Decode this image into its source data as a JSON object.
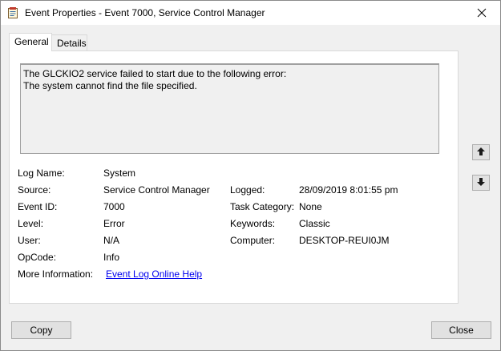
{
  "window": {
    "title": "Event Properties - Event 7000, Service Control Manager"
  },
  "tabs": [
    {
      "label": "General"
    },
    {
      "label": "Details"
    }
  ],
  "description": {
    "line1": "The GLCKIO2 service failed to start due to the following error:",
    "line2": "The system cannot find the file specified."
  },
  "fields": {
    "log_name": {
      "label": "Log Name:",
      "value": "System"
    },
    "source": {
      "label": "Source:",
      "value": "Service Control Manager"
    },
    "event_id": {
      "label": "Event ID:",
      "value": "7000"
    },
    "level": {
      "label": "Level:",
      "value": "Error"
    },
    "user": {
      "label": "User:",
      "value": "N/A"
    },
    "opcode": {
      "label": "OpCode:",
      "value": "Info"
    },
    "more_info": {
      "label": "More Information:",
      "link": "Event Log Online Help"
    },
    "logged": {
      "label": "Logged:",
      "value": "28/09/2019 8:01:55 pm"
    },
    "task_category": {
      "label": "Task Category:",
      "value": "None"
    },
    "keywords": {
      "label": "Keywords:",
      "value": "Classic"
    },
    "computer": {
      "label": "Computer:",
      "value": "DESKTOP-REUI0JM"
    }
  },
  "buttons": {
    "copy": "Copy",
    "close": "Close"
  },
  "icons": {
    "app": "event-viewer-icon",
    "close": "close-icon",
    "up": "arrow-up-icon",
    "down": "arrow-down-icon"
  },
  "colors": {
    "link": "#0000ee",
    "window_bg": "#f0f0f0",
    "panel_bg": "#ffffff"
  }
}
